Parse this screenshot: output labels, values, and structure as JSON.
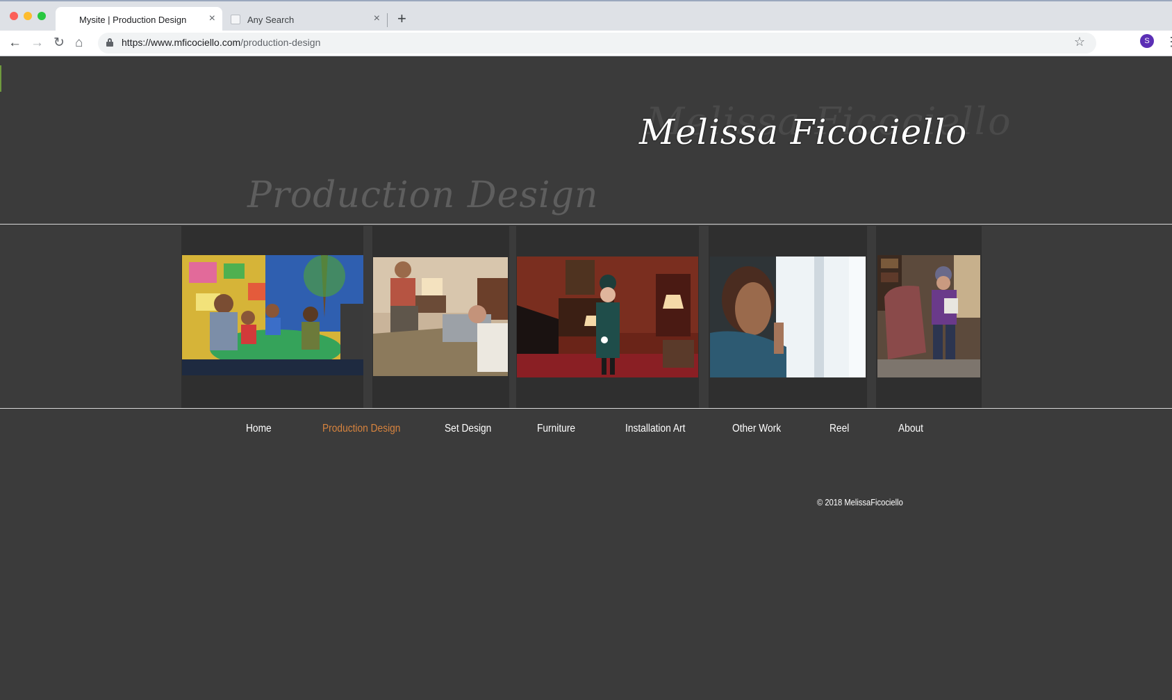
{
  "browser": {
    "tabs": [
      {
        "label": "Mysite | Production Design",
        "active": true
      },
      {
        "label": "Any Search",
        "active": false
      }
    ],
    "new_tab_label": "+",
    "tab_close_glyph": "×",
    "url_host": "https://www.mficociello.com",
    "url_path": "/production-design",
    "profile_initial": "S",
    "icons": {
      "back": "←",
      "forward": "→",
      "reload": "↻",
      "home": "⌂",
      "star": "☆",
      "menu": "⋮"
    }
  },
  "site": {
    "name": "Melissa Ficociello",
    "page_heading": "Production Design",
    "accent_color": "#d8843e",
    "background_color": "#3b3b3b"
  },
  "gallery": [
    {
      "name": "classroom-photo"
    },
    {
      "name": "bedroom-photo"
    },
    {
      "name": "hotel-room-photo"
    },
    {
      "name": "window-photo"
    },
    {
      "name": "reading-chair-photo"
    }
  ],
  "nav": {
    "items": [
      {
        "label": "Home"
      },
      {
        "label": "Production Design",
        "active": true
      },
      {
        "label": "Set Design"
      },
      {
        "label": "Furniture"
      },
      {
        "label": "Installation Art"
      },
      {
        "label": "Other Work"
      },
      {
        "label": "Reel"
      },
      {
        "label": "About"
      }
    ]
  },
  "footer": {
    "copyright": "© 2018 MelissaFicociello"
  }
}
